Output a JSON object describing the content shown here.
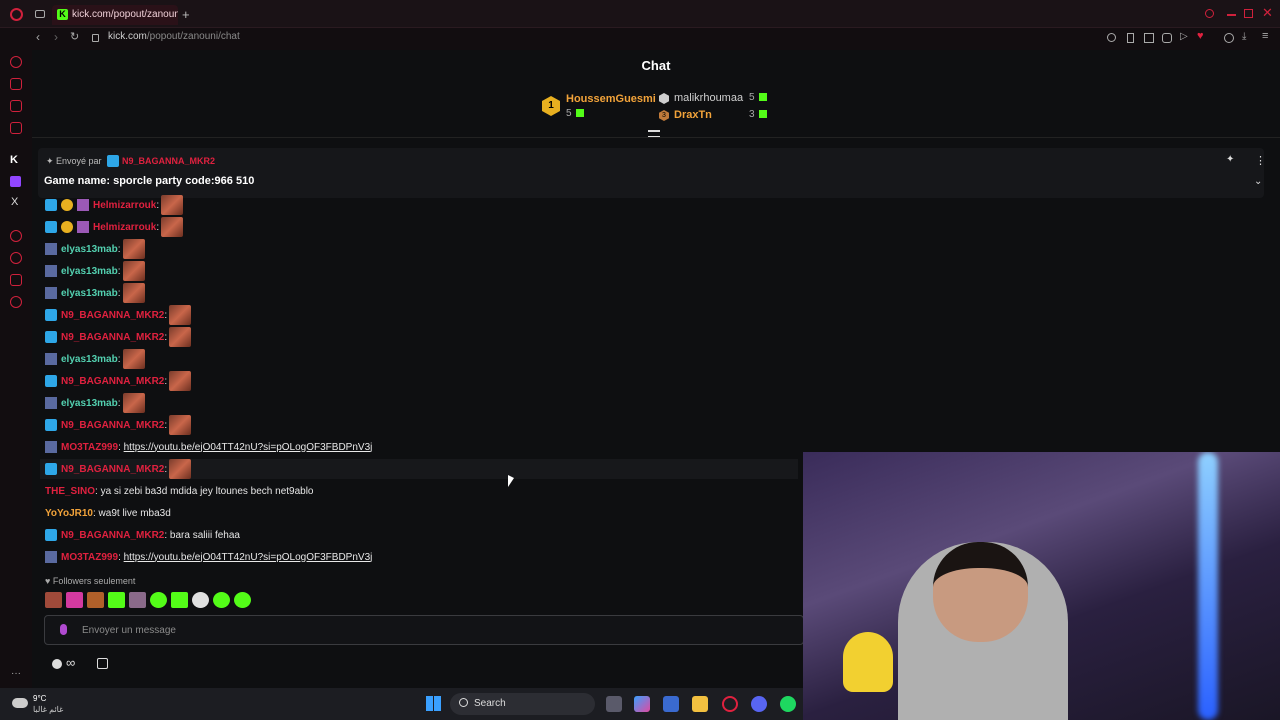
{
  "browser": {
    "tab_title": "kick.com/popout/zanouni",
    "url_host": "kick.com",
    "url_path": "/popout/zanouni/chat"
  },
  "chat": {
    "title": "Chat",
    "leaderboard": [
      {
        "rank": "1",
        "name": "HoussemGuesmi",
        "count": "5",
        "color": "#f2a33a"
      },
      {
        "rank": "",
        "name": "malikrhoumaa",
        "count": "5",
        "color": "#cfcfcf"
      },
      {
        "rank": "3",
        "name": "DraxTn",
        "count": "3",
        "color": "#f2a33a"
      }
    ],
    "pinned": {
      "sent_by_label": "Envoyé par",
      "sent_by_user": "N9_BAGANNA_MKR2",
      "text": "Game name: sporcle party code:966 510"
    },
    "messages": [
      {
        "user": "Helmizarrouk",
        "color": "red",
        "text": ""
      },
      {
        "user": "Helmizarrouk",
        "color": "red",
        "text": ""
      },
      {
        "user": "elyas13mab",
        "color": "green",
        "text": ""
      },
      {
        "user": "elyas13mab",
        "color": "green",
        "text": ""
      },
      {
        "user": "elyas13mab",
        "color": "green",
        "text": ""
      },
      {
        "user": "N9_BAGANNA_MKR2",
        "color": "red",
        "text": ""
      },
      {
        "user": "N9_BAGANNA_MKR2",
        "color": "red",
        "text": ""
      },
      {
        "user": "elyas13mab",
        "color": "green",
        "text": ""
      },
      {
        "user": "N9_BAGANNA_MKR2",
        "color": "red",
        "text": ""
      },
      {
        "user": "elyas13mab",
        "color": "green",
        "text": ""
      },
      {
        "user": "N9_BAGANNA_MKR2",
        "color": "red",
        "text": ""
      },
      {
        "user": "MO3TAZ999",
        "color": "red",
        "text": "https://youtu.be/ejO04TT42nU?si=pOLogOF3FBDPnV3j"
      },
      {
        "user": "N9_BAGANNA_MKR2",
        "color": "red",
        "text": ""
      },
      {
        "user": "THE_SINO",
        "color": "red",
        "text": "ya si zebi ba3d mdida jey ltounes bech net9ablo"
      },
      {
        "user": "YoYoJR10",
        "color": "orange",
        "text": "wa9t live mba3d"
      },
      {
        "user": "N9_BAGANNA_MKR2",
        "color": "red",
        "text": "bara saliii fehaa"
      },
      {
        "user": "MO3TAZ999",
        "color": "red",
        "text": "https://youtu.be/ejO04TT42nU?si=pOLogOF3FBDPnV3j"
      }
    ],
    "followers_only": "Followers seulement",
    "input_placeholder": "Envoyer un message"
  },
  "taskbar": {
    "weather_temp": "9°C",
    "weather_desc": "غائم غالبا",
    "search_label": "Search"
  },
  "colors": {
    "accent": "#e0213f",
    "kick_green": "#53fc18"
  }
}
